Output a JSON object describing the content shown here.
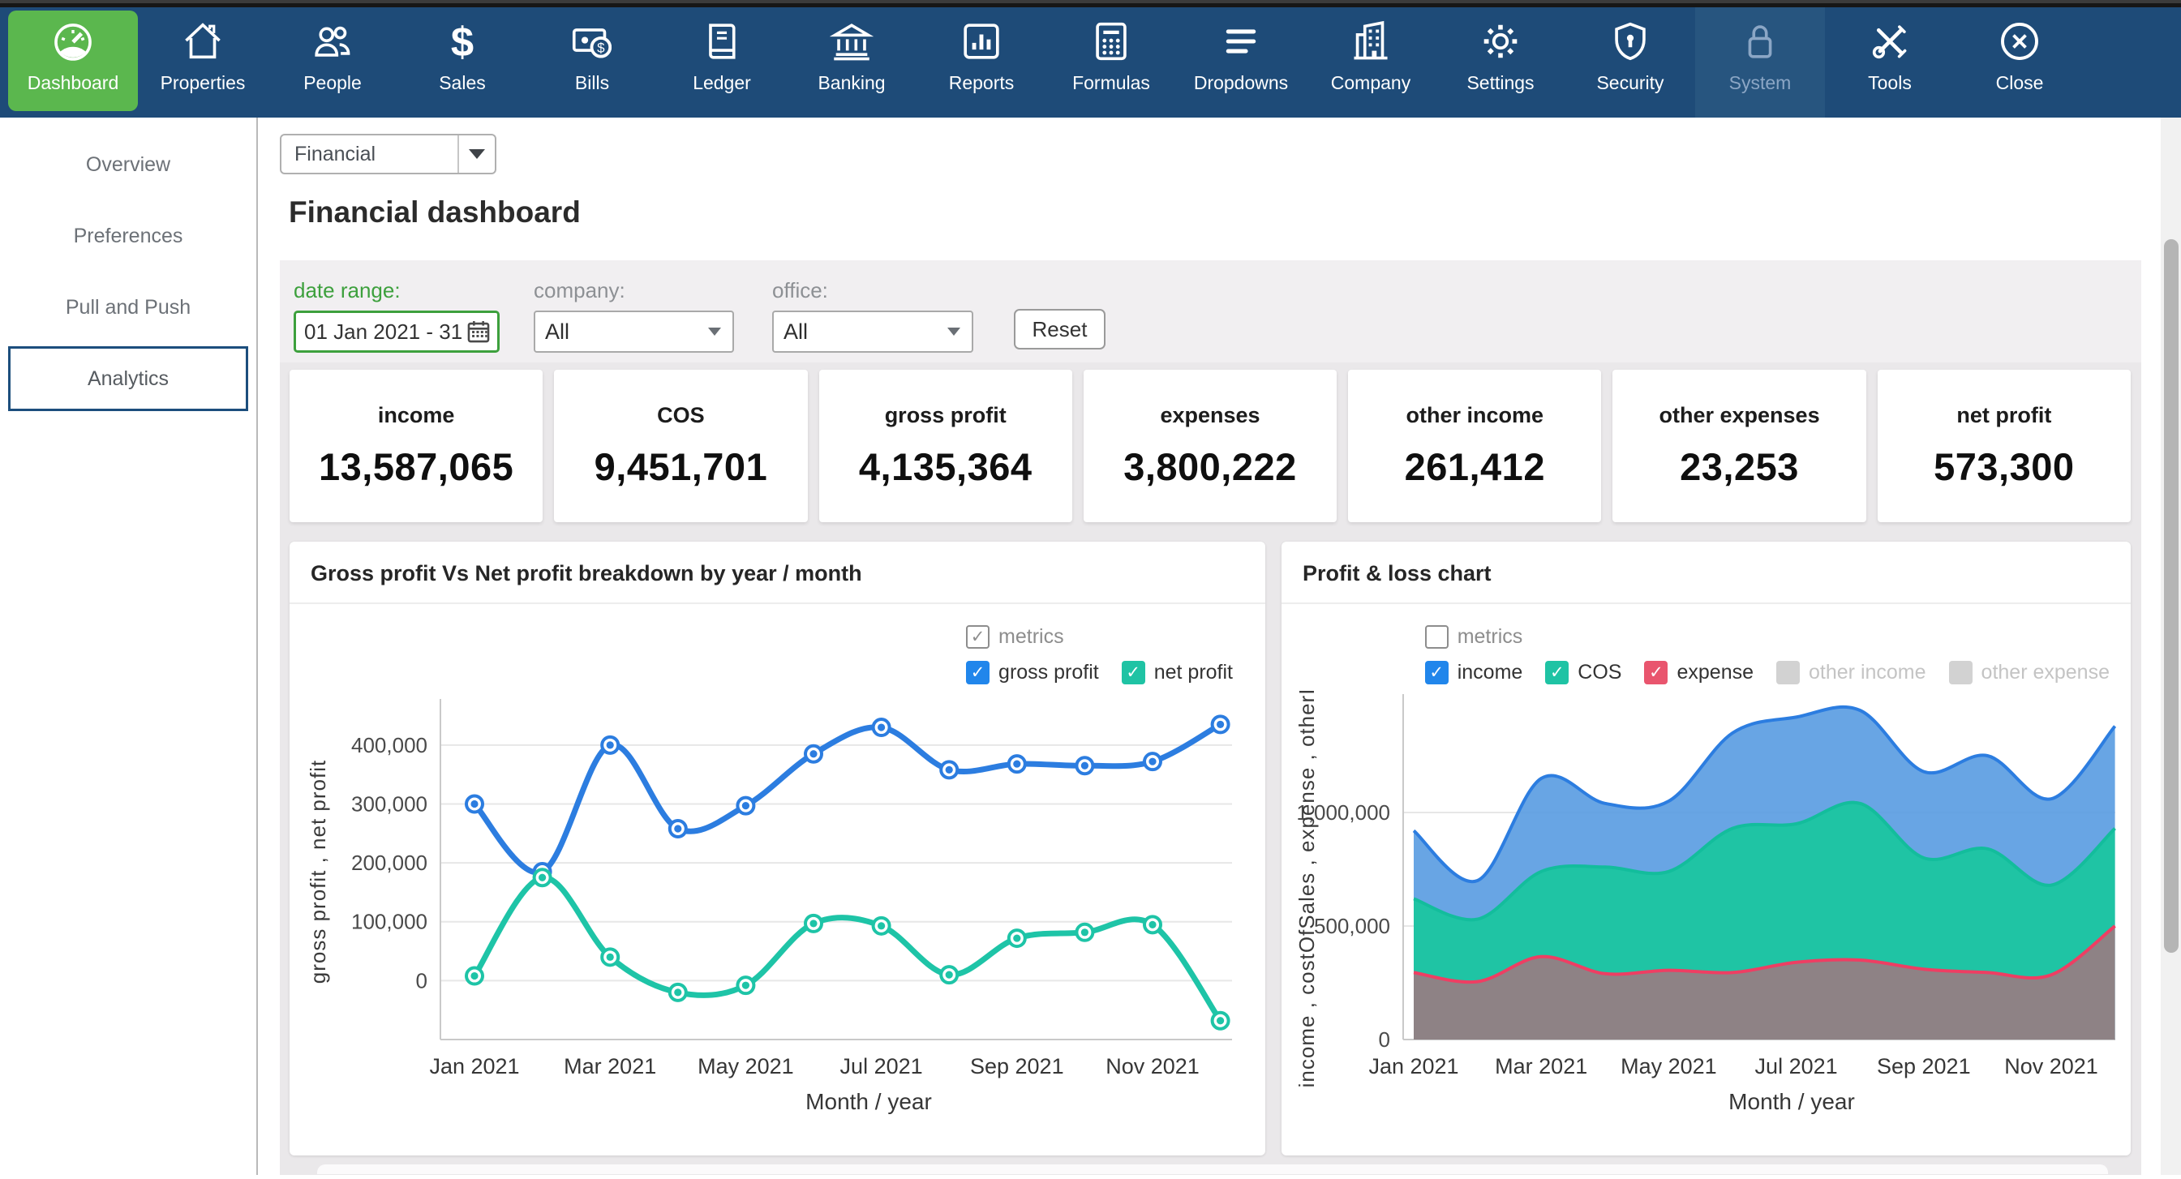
{
  "nav": {
    "items": [
      {
        "label": "Dashboard",
        "icon": "dashboard-gauge",
        "state": "active"
      },
      {
        "label": "Properties",
        "icon": "house"
      },
      {
        "label": "People",
        "icon": "people"
      },
      {
        "label": "Sales",
        "icon": "dollar"
      },
      {
        "label": "Bills",
        "icon": "bills"
      },
      {
        "label": "Ledger",
        "icon": "ledger"
      },
      {
        "label": "Banking",
        "icon": "bank"
      },
      {
        "label": "Reports",
        "icon": "report-chart"
      },
      {
        "label": "Formulas",
        "icon": "calculator"
      },
      {
        "label": "Dropdowns",
        "icon": "menu-lines"
      },
      {
        "label": "Company",
        "icon": "building"
      },
      {
        "label": "Settings",
        "icon": "gear"
      },
      {
        "label": "Security",
        "icon": "shield"
      },
      {
        "label": "System",
        "icon": "lock",
        "state": "disabled"
      },
      {
        "label": "Tools",
        "icon": "tools"
      },
      {
        "label": "Close",
        "icon": "close-circle"
      }
    ]
  },
  "sidebar": {
    "items": [
      {
        "label": "Overview",
        "active": false
      },
      {
        "label": "Preferences",
        "active": false
      },
      {
        "label": "Pull and Push",
        "active": false
      },
      {
        "label": "Analytics",
        "active": true
      }
    ]
  },
  "page": {
    "module_select_value": "Financial",
    "title": "Financial dashboard"
  },
  "filters": {
    "date_range_label": "date range:",
    "date_range_value": "01 Jan 2021 - 31",
    "company_label": "company:",
    "company_value": "All",
    "office_label": "office:",
    "office_value": "All",
    "reset_label": "Reset"
  },
  "kpis": [
    {
      "label": "income",
      "value": "13,587,065"
    },
    {
      "label": "COS",
      "value": "9,451,701"
    },
    {
      "label": "gross profit",
      "value": "4,135,364"
    },
    {
      "label": "expenses",
      "value": "3,800,222"
    },
    {
      "label": "other income",
      "value": "261,412"
    },
    {
      "label": "other expenses",
      "value": "23,253"
    },
    {
      "label": "net profit",
      "value": "573,300"
    }
  ],
  "colors": {
    "nav_bg": "#1e4b78",
    "active_green": "#5bb74e",
    "accent_green": "#3da03d",
    "series_blue": "#2c7de0",
    "series_teal": "#1ec4a7",
    "series_crimson": "#ee3e63",
    "page_gray": "#eae8ea"
  },
  "chart_data": [
    {
      "type": "line",
      "title": "Gross profit Vs Net profit breakdown by year / month",
      "x": [
        "Jan 2021",
        "Feb 2021",
        "Mar 2021",
        "Apr 2021",
        "May 2021",
        "Jun 2021",
        "Jul 2021",
        "Aug 2021",
        "Sep 2021",
        "Oct 2021",
        "Nov 2021",
        "Dec 2021"
      ],
      "x_tick_labels": [
        "Jan 2021",
        "Mar 2021",
        "May 2021",
        "Jul 2021",
        "Sep 2021",
        "Nov 2021"
      ],
      "series": [
        {
          "name": "gross profit",
          "color": "#2c7de0",
          "values": [
            300000,
            185000,
            400000,
            258000,
            297000,
            385000,
            430000,
            358000,
            368000,
            365000,
            372000,
            435000
          ]
        },
        {
          "name": "net profit",
          "color": "#1ec4a7",
          "values": [
            8000,
            175000,
            40000,
            -20000,
            -8000,
            97000,
            93000,
            10000,
            72000,
            82000,
            95000,
            -68000
          ]
        }
      ],
      "legend": {
        "group_label": "metrics",
        "group_checked": true,
        "items": [
          {
            "name": "gross profit",
            "color": "#2186eb",
            "checked": true
          },
          {
            "name": "net profit",
            "color": "#1fc3a4",
            "checked": true
          }
        ]
      },
      "xlabel": "Month / year",
      "ylabel": "gross profit , net profit",
      "ylim": [
        -100000,
        470000
      ],
      "yticks": [
        0,
        100000,
        200000,
        300000,
        400000
      ],
      "grid": true,
      "legend_position": "top-right"
    },
    {
      "type": "area",
      "title": "Profit & loss chart",
      "x": [
        "Jan 2021",
        "Feb 2021",
        "Mar 2021",
        "Apr 2021",
        "May 2021",
        "Jun 2021",
        "Jul 2021",
        "Aug 2021",
        "Sep 2021",
        "Oct 2021",
        "Nov 2021",
        "Dec 2021"
      ],
      "x_tick_labels": [
        "Jan 2021",
        "Mar 2021",
        "May 2021",
        "Jul 2021",
        "Sep 2021",
        "Nov 2021"
      ],
      "series": [
        {
          "name": "income",
          "color": "#2c7de0",
          "fill": "#5b9de2",
          "fill_opacity": 0.92,
          "values": [
            920000,
            700000,
            1150000,
            1040000,
            1050000,
            1350000,
            1420000,
            1450000,
            1180000,
            1250000,
            1060000,
            1380000
          ]
        },
        {
          "name": "COS",
          "color": "#13bd9c",
          "fill": "#1fc4a4",
          "fill_opacity": 1,
          "values": [
            620000,
            530000,
            740000,
            760000,
            740000,
            930000,
            950000,
            1040000,
            800000,
            840000,
            680000,
            930000
          ]
        },
        {
          "name": "expense",
          "color": "#ee3e63",
          "fill": "#e94d6c",
          "fill_opacity": 0.55,
          "values": [
            295000,
            255000,
            365000,
            290000,
            305000,
            295000,
            340000,
            350000,
            310000,
            295000,
            285000,
            500000
          ]
        }
      ],
      "legend": {
        "group_label": "metrics",
        "group_checked": false,
        "items": [
          {
            "name": "income",
            "color": "#2186eb",
            "checked": true
          },
          {
            "name": "COS",
            "color": "#1fc3a4",
            "checked": true
          },
          {
            "name": "expense",
            "color": "#e9556e",
            "checked": true
          },
          {
            "name": "other income",
            "color": "#d2d2d2",
            "checked": false
          },
          {
            "name": "other expense",
            "color": "#d2d2d2",
            "checked": false
          }
        ]
      },
      "xlabel": "Month / year",
      "ylabel": "income , costOfSales , expense , otherInc..",
      "ylim": [
        0,
        1500000
      ],
      "yticks": [
        0,
        500000,
        1000000
      ],
      "grid": true,
      "legend_position": "top-right"
    }
  ]
}
